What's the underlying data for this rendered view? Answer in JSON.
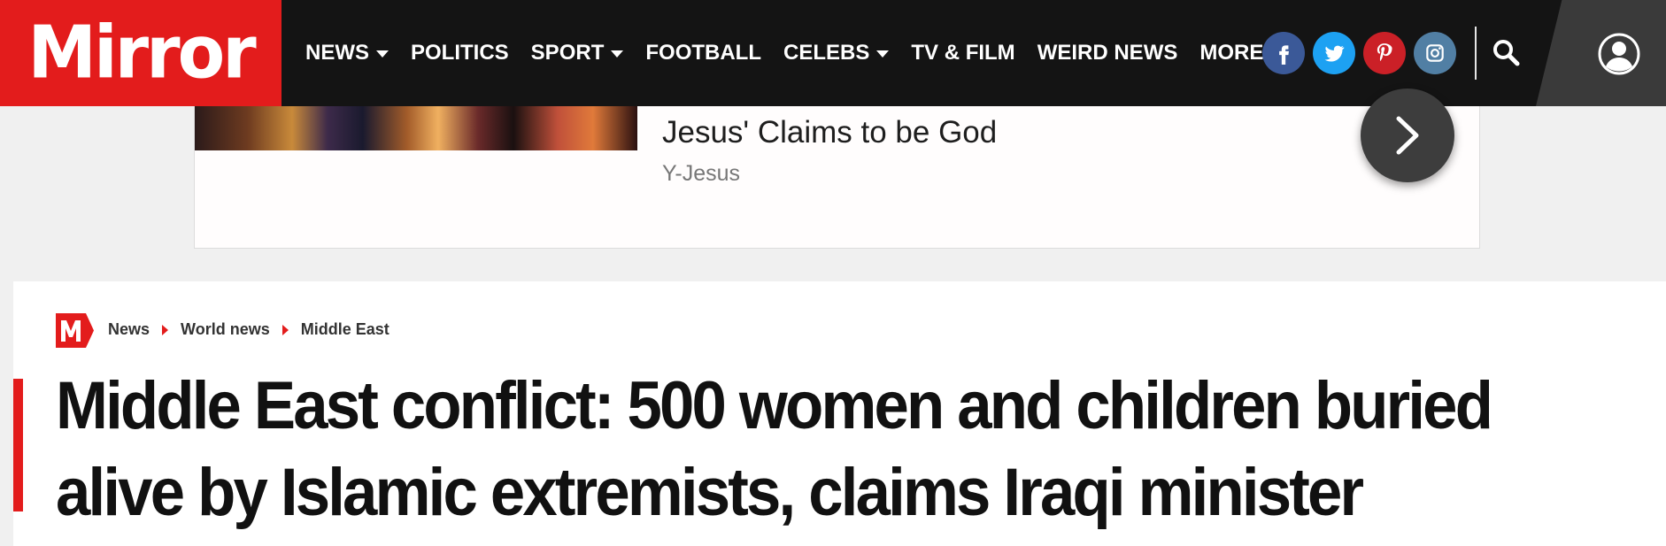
{
  "brand": {
    "logo_text": "Mirror",
    "accent_color": "#e31c1c",
    "nav_bg": "#141414"
  },
  "nav": {
    "items": [
      {
        "label": "NEWS",
        "has_dropdown": true
      },
      {
        "label": "POLITICS",
        "has_dropdown": false
      },
      {
        "label": "SPORT",
        "has_dropdown": true
      },
      {
        "label": "FOOTBALL",
        "has_dropdown": false
      },
      {
        "label": "CELEBS",
        "has_dropdown": true
      },
      {
        "label": "TV & FILM",
        "has_dropdown": false
      },
      {
        "label": "WEIRD NEWS",
        "has_dropdown": false
      },
      {
        "label": "MORE",
        "has_dropdown": true
      }
    ],
    "socials": [
      {
        "name": "facebook-icon",
        "color": "#3b5998"
      },
      {
        "name": "twitter-icon",
        "color": "#1da1f2"
      },
      {
        "name": "pinterest-icon",
        "color": "#cb2027"
      },
      {
        "name": "instagram-icon",
        "color": "#517fa4"
      }
    ]
  },
  "promo": {
    "title": "Jesus' Claims to be God",
    "source": "Y-Jesus"
  },
  "article": {
    "breadcrumb": [
      "News",
      "World news",
      "Middle East"
    ],
    "headline": "Middle East conflict: 500 women and children buried alive by Islamic extremists, claims Iraqi minister"
  }
}
